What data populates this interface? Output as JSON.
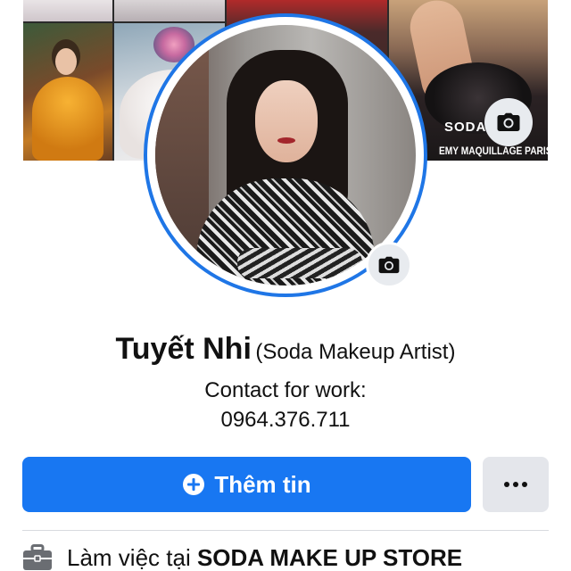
{
  "profile": {
    "name": "Tuyết Nhi",
    "alt_name": "(Soda Makeup Artist)",
    "bio_line1": "Contact for work:",
    "bio_line2": "0964.376.711"
  },
  "cover": {
    "photo_text_line1": "SODA",
    "photo_text_line2": "EMY MAQUILLAGE PARIS"
  },
  "actions": {
    "add_story_label": "Thêm tin",
    "more_icon": "more-dots-icon",
    "add_icon": "plus-circle-icon",
    "camera_icon": "camera-icon"
  },
  "details": {
    "work_prefix": "Làm việc tại ",
    "work_place": "SODA MAKE UP STORE",
    "work_icon": "briefcase-icon"
  },
  "colors": {
    "accent": "#1877f2",
    "ring": "#1f76e6",
    "secondary_button": "#e4e6eb",
    "text": "#111111"
  }
}
